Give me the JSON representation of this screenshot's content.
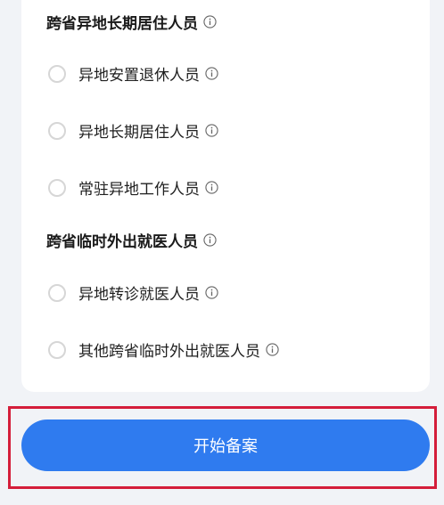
{
  "groups": [
    {
      "title": "跨省异地长期居住人员",
      "options": [
        {
          "label": "异地安置退休人员",
          "selected": false
        },
        {
          "label": "异地长期居住人员",
          "selected": false
        },
        {
          "label": "常驻异地工作人员",
          "selected": false
        }
      ]
    },
    {
      "title": "跨省临时外出就医人员",
      "options": [
        {
          "label": "异地转诊就医人员",
          "selected": false
        },
        {
          "label": "其他跨省临时外出就医人员",
          "selected": false
        }
      ]
    }
  ],
  "actions": {
    "start_label": "开始备案"
  },
  "colors": {
    "primary": "#2f7bef",
    "highlight": "#d41d3a",
    "radio_border": "#d6d6d6",
    "page_background": "#f1f3f7"
  },
  "icons": {
    "info": "info-circle-icon"
  }
}
